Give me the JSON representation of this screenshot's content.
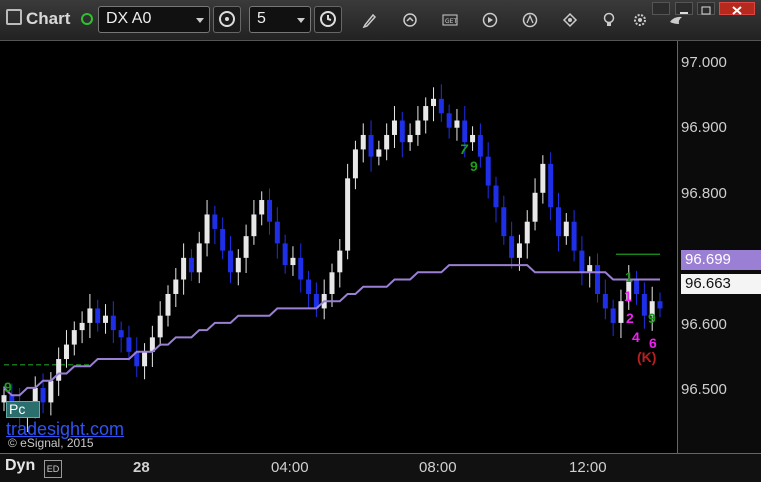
{
  "toolbar": {
    "app_title": "Chart",
    "symbol": "DX A0",
    "interval": "5"
  },
  "icons": [
    "chart-icon",
    "status-dot-icon",
    "symbol-dropdown-icon",
    "gear-clock-icon",
    "interval-dropdown-icon",
    "clock-icon",
    "pencil-icon",
    "refresh-icon",
    "get-icon",
    "play-icon",
    "analysis-icon",
    "bookmark-icon",
    "lightbulb-icon",
    "settings-icon",
    "bird-icon"
  ],
  "colors": {
    "up_bar": "#e8e8e8",
    "down_bar": "#1f2fe8",
    "average_line": "#9b7fd4",
    "setup_green": "#1e9a1e",
    "count_magenta": "#ee22ee",
    "count_red": "#b82020"
  },
  "axes": {
    "y_ticks": [
      "97.000",
      "96.900",
      "96.800",
      "96.600",
      "96.500"
    ],
    "x_ticks": [
      "28",
      "04:00",
      "08:00",
      "12:00"
    ]
  },
  "badges": {
    "average": "96.699",
    "last_price": "96.663"
  },
  "markers": {
    "setup_a": [
      "7",
      "9"
    ],
    "setup_b": [
      "1",
      "9"
    ],
    "count_labels": [
      "1",
      "2",
      "4",
      "6"
    ],
    "countdown_label": "(K)",
    "left_label": "9"
  },
  "bottom": {
    "dyn_label": "Dyn",
    "dyn_box": "ED"
  },
  "overlay": {
    "pc_button": "Pc",
    "watermark": "tradesight.com",
    "copyright": "© eSignal, 2015"
  },
  "chart_data": {
    "type": "candlestick",
    "ylim": [
      96.46,
      97.03
    ],
    "x_ticks": [
      "28",
      "04:00",
      "08:00",
      "12:00"
    ],
    "yticks": [
      96.5,
      96.6,
      96.8,
      96.9,
      97.0
    ],
    "series": [
      {
        "values": [
          96.54,
          96.53,
          96.51,
          96.52,
          96.55,
          96.53,
          96.56,
          96.59,
          96.61,
          96.63,
          96.64,
          96.66,
          96.64,
          96.65,
          96.63,
          96.62,
          96.6,
          96.58,
          96.6,
          96.62,
          96.65,
          96.68,
          96.7,
          96.73,
          96.71,
          96.75,
          96.79,
          96.77,
          96.74,
          96.71,
          96.73,
          96.76,
          96.79,
          96.81,
          96.78,
          96.75,
          96.72,
          96.73,
          96.7,
          96.68,
          96.66,
          96.68,
          96.71,
          96.74,
          96.84,
          96.88,
          96.9,
          96.87,
          96.88,
          96.9,
          96.92,
          96.89,
          96.9,
          96.92,
          96.94,
          96.95,
          96.93,
          96.91,
          96.92,
          96.89,
          96.9,
          96.87,
          96.83,
          96.8,
          96.76,
          96.73,
          96.75,
          96.78,
          96.82,
          96.86,
          96.8,
          96.76,
          96.78,
          96.74,
          96.71,
          96.72,
          96.68,
          96.66,
          96.64,
          96.67,
          96.7,
          96.68,
          96.65,
          96.67,
          96.66
        ]
      },
      {
        "name": "average",
        "values": [
          96.55,
          96.54,
          96.54,
          96.55,
          96.55,
          96.56,
          96.56,
          96.57,
          96.57,
          96.58,
          96.58,
          96.58,
          96.59,
          96.59,
          96.59,
          96.59,
          96.59,
          96.6,
          96.6,
          96.6,
          96.61,
          96.61,
          96.62,
          96.62,
          96.62,
          96.63,
          96.63,
          96.64,
          96.64,
          96.64,
          96.65,
          96.65,
          96.65,
          96.65,
          96.65,
          96.66,
          96.66,
          96.66,
          96.66,
          96.66,
          96.66,
          96.67,
          96.67,
          96.67,
          96.68,
          96.68,
          96.69,
          96.69,
          96.69,
          96.69,
          96.7,
          96.7,
          96.7,
          96.71,
          96.71,
          96.71,
          96.71,
          96.72,
          96.72,
          96.72,
          96.72,
          96.72,
          96.72,
          96.72,
          96.72,
          96.72,
          96.72,
          96.72,
          96.71,
          96.71,
          96.71,
          96.71,
          96.71,
          96.71,
          96.71,
          96.71,
          96.71,
          96.71,
          96.7,
          96.7,
          96.7,
          96.7,
          96.7,
          96.7,
          96.7
        ]
      }
    ]
  }
}
